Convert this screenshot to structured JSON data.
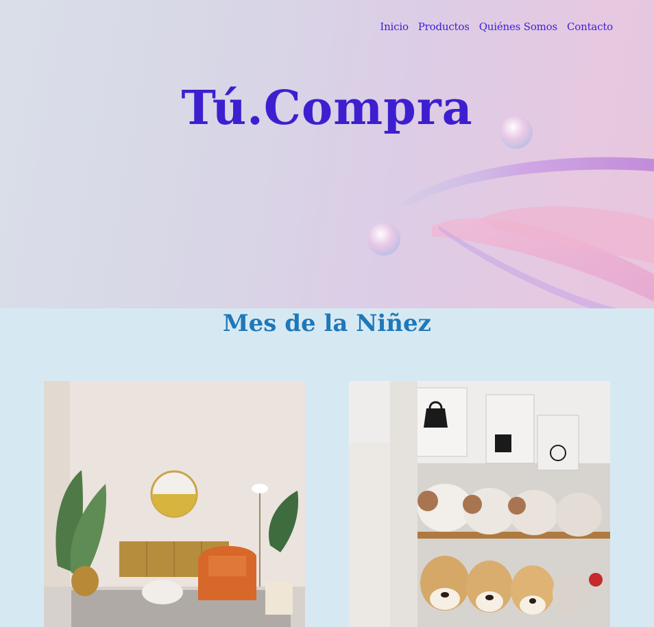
{
  "nav": {
    "items": [
      {
        "label": "Inicio"
      },
      {
        "label": "Productos"
      },
      {
        "label": "Quiénes Somos"
      },
      {
        "label": "Contacto"
      }
    ]
  },
  "hero": {
    "brand": "Tú.Compra"
  },
  "section": {
    "title": "Mes de la Niñez"
  },
  "cards": [
    {
      "image": "living-room-photo"
    },
    {
      "image": "plush-toys-shelf-photo"
    }
  ],
  "colors": {
    "brand": "#3d1fd0",
    "nav_link": "#3a1fd6",
    "section_title": "#1f78b8",
    "page_background": "#d6e9f3"
  }
}
